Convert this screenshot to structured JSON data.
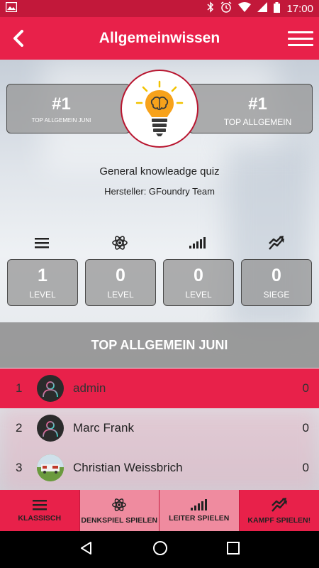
{
  "status": {
    "time": "17:00"
  },
  "app": {
    "title": "Allgemeinwissen"
  },
  "ranks": {
    "left": {
      "value": "#1",
      "label": "TOP ALLGEMEIN JUNI"
    },
    "right": {
      "value": "#1",
      "label": "TOP ALLGEMEIN"
    }
  },
  "quiz": {
    "description": "General knowleadge quiz",
    "author": "Hersteller: GFoundry Team"
  },
  "stats": [
    {
      "icon": "list-icon",
      "value": "1",
      "label": "LEVEL"
    },
    {
      "icon": "atom-icon",
      "value": "0",
      "label": "LEVEL"
    },
    {
      "icon": "signal-bars-icon",
      "value": "0",
      "label": "LEVEL"
    },
    {
      "icon": "battle-arrows-icon",
      "value": "0",
      "label": "SIEGE"
    }
  ],
  "leaderboard": {
    "title": "TOP ALLGEMEIN JUNI",
    "rows": [
      {
        "rank": "1",
        "name": "admin",
        "score": "0"
      },
      {
        "rank": "2",
        "name": "Marc Frank",
        "score": "0"
      },
      {
        "rank": "3",
        "name": "Christian Weissbrich",
        "score": "0"
      }
    ]
  },
  "tabs": [
    {
      "icon": "list-icon",
      "label": "KLASSISCH"
    },
    {
      "icon": "atom-icon",
      "label": "DENKSPIEL SPIELEN"
    },
    {
      "icon": "signal-bars-icon",
      "label": "LEITER SPIELEN"
    },
    {
      "icon": "battle-arrows-icon",
      "label": "KAMPF SPIELEN!"
    }
  ],
  "colors": {
    "accent": "#e8214a",
    "status_bar": "#c2183a",
    "tab_alt": "#ef8b9f"
  }
}
